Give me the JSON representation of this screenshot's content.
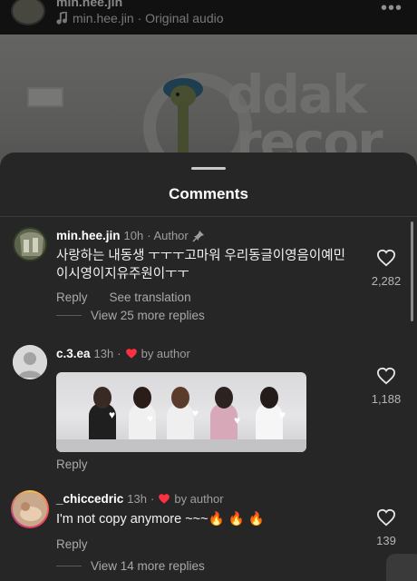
{
  "reel": {
    "username": "min.hee.jin",
    "audio": "min.hee.jin · Original audio",
    "watermark_line1": "ddak",
    "watermark_line2": "recor"
  },
  "sheet": {
    "title": "Comments"
  },
  "comments": [
    {
      "username": "min.hee.jin",
      "time": "10h",
      "tag": "· Author",
      "text": "사랑하는 내동생 ㅜㅜㅜ고마워 우리동글이영음이예민이시영이지유주원이ㅜㅜ",
      "reply_label": "Reply",
      "translate_label": "See translation",
      "view_more": "View 25 more replies",
      "likes": "2,282",
      "pinned": true
    },
    {
      "username": "c.3.ea",
      "time": "13h",
      "tag": "by author",
      "reply_label": "Reply",
      "likes": "1,188",
      "has_gif": true
    },
    {
      "username": "_chiccedric",
      "time": "13h",
      "tag": "by author",
      "text": "I'm not copy anymore ~~~🔥 🔥 🔥",
      "reply_label": "Reply",
      "view_more": "View 14 more replies",
      "likes": "139"
    }
  ],
  "colors": {
    "sheet_bg": "#262626",
    "heart_red": "#ff3040",
    "muted_text": "#a9a9a9"
  }
}
